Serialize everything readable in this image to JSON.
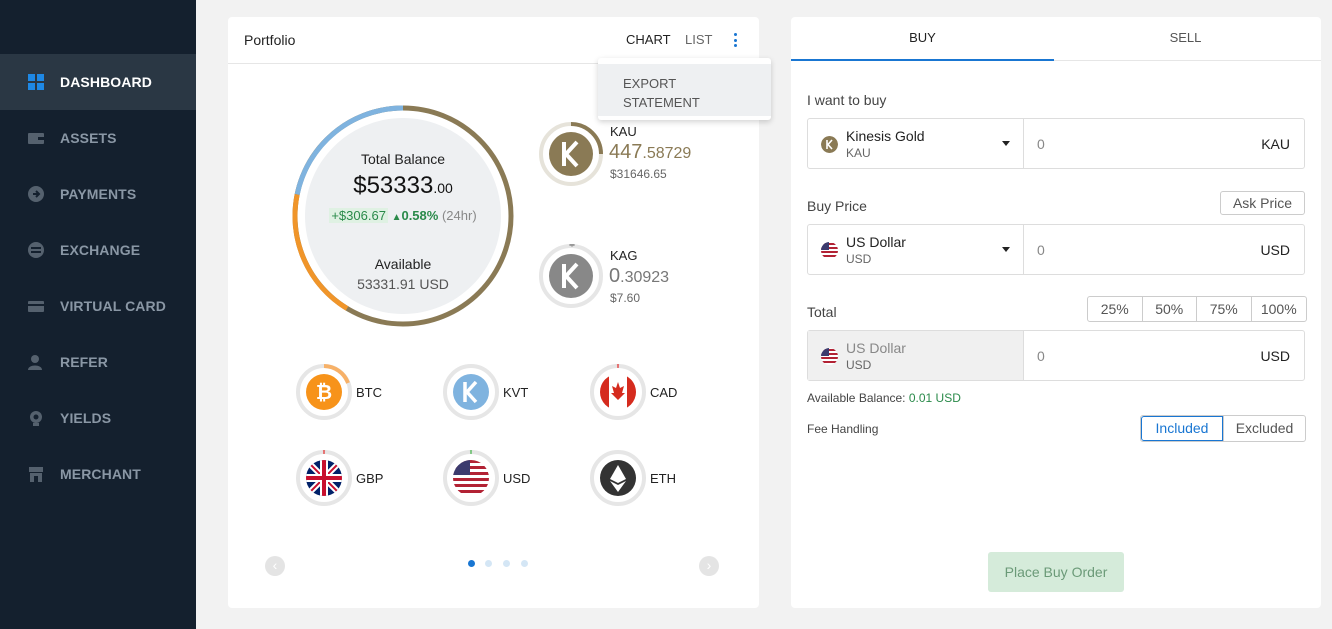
{
  "sidebar": {
    "items": [
      {
        "label": "DASHBOARD",
        "icon": "dashboard-grid-icon",
        "active": true
      },
      {
        "label": "ASSETS",
        "icon": "wallet-icon"
      },
      {
        "label": "PAYMENTS",
        "icon": "arrow-circle-icon"
      },
      {
        "label": "EXCHANGE",
        "icon": "exchange-icon"
      },
      {
        "label": "VIRTUAL CARD",
        "icon": "card-icon"
      },
      {
        "label": "REFER",
        "icon": "user-plus-icon"
      },
      {
        "label": "YIELDS",
        "icon": "yield-icon"
      },
      {
        "label": "MERCHANT",
        "icon": "store-icon"
      }
    ]
  },
  "portfolio": {
    "title": "Portfolio",
    "tab_chart": "CHART",
    "tab_list": "LIST",
    "menu": {
      "item": "EXPORT\nSTATEMENT"
    },
    "balance": {
      "label": "Total Balance",
      "amount_main": "$53333",
      "amount_dec": ".00",
      "change_value": "+$306.67",
      "change_pct": "0.58%",
      "change_period": "(24hr)",
      "available_label": "Available",
      "available_value": "53331.91 USD"
    },
    "kau": {
      "name": "KAU",
      "amount_int": "447",
      "amount_dec": ".58729",
      "usd": "$31646.65"
    },
    "kag": {
      "name": "KAG",
      "amount_int": "0",
      "amount_dec": ".30923",
      "usd": "$7.60"
    },
    "coins": [
      {
        "name": "BTC",
        "icon": "bitcoin-icon"
      },
      {
        "name": "KVT",
        "icon": "kinesis-kvt-icon"
      },
      {
        "name": "CAD",
        "icon": "canada-flag-icon"
      },
      {
        "name": "GBP",
        "icon": "uk-flag-icon"
      },
      {
        "name": "USD",
        "icon": "us-flag-icon"
      },
      {
        "name": "ETH",
        "icon": "ethereum-icon"
      }
    ],
    "pager": {
      "pages": 4,
      "active": 0
    }
  },
  "trade": {
    "tab_buy": "BUY",
    "tab_sell": "SELL",
    "want_label": "I want to buy",
    "buy_asset": {
      "name": "Kinesis Gold",
      "code": "KAU",
      "value": "0",
      "unit": "KAU"
    },
    "price_label": "Buy Price",
    "ask_price_button": "Ask Price",
    "price_currency": {
      "name": "US Dollar",
      "code": "USD",
      "value": "0",
      "unit": "USD"
    },
    "total_label": "Total",
    "pct_buttons": [
      "25%",
      "50%",
      "75%",
      "100%"
    ],
    "total_currency": {
      "name": "US Dollar",
      "code": "USD",
      "value": "0",
      "unit": "USD"
    },
    "available_balance_label": "Available Balance:",
    "available_balance_value": "0.01 USD",
    "fee_label": "Fee Handling",
    "fee_included": "Included",
    "fee_excluded": "Excluded",
    "place_button": "Place Buy Order"
  },
  "colors": {
    "sidebar_bg": "#14202e",
    "accent": "#1976d2",
    "gold": "#8a7a55",
    "green": "#2a8a4a",
    "ring_blue": "#7fb3df",
    "ring_orange": "#f0952a"
  }
}
